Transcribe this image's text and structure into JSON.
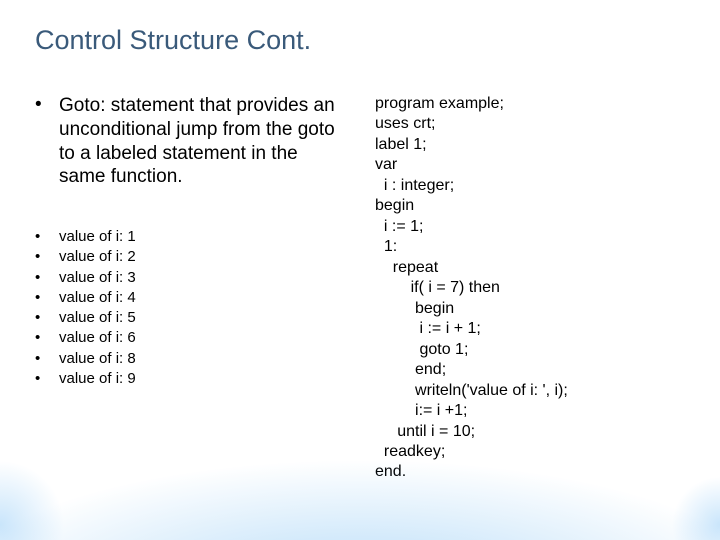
{
  "title": "Control Structure Cont.",
  "mainBullet": {
    "mark": "•",
    "text": "Goto: statement that provides an unconditional jump from the goto to a labeled statement in the same function."
  },
  "outputs": [
    {
      "mark": "•",
      "text": "value of i: 1"
    },
    {
      "mark": "•",
      "text": "value of i: 2"
    },
    {
      "mark": "•",
      "text": "value of i: 3"
    },
    {
      "mark": "•",
      "text": "value of i: 4"
    },
    {
      "mark": "•",
      "text": "value of i: 5"
    },
    {
      "mark": "•",
      "text": "value of i: 6"
    },
    {
      "mark": "•",
      "text": "value of i: 8"
    },
    {
      "mark": "•",
      "text": "value of i: 9"
    }
  ],
  "code": "program example;\nuses crt;\nlabel 1;\nvar\n  i : integer;\nbegin\n  i := 1;\n  1:\n    repeat\n        if( i = 7) then\n         begin\n          i := i + 1;\n          goto 1;\n         end;\n         writeln('value of i: ', i);\n         i:= i +1;\n     until i = 10;\n  readkey;\nend."
}
